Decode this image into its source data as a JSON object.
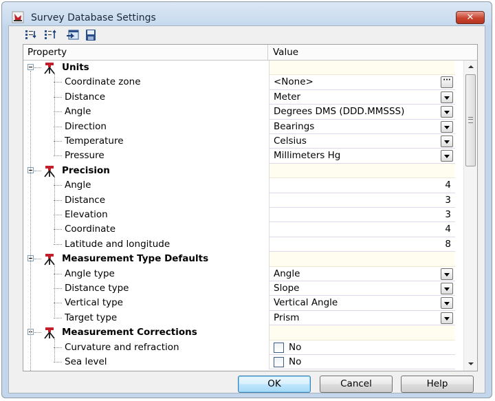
{
  "window": {
    "title": "Survey Database Settings",
    "close_label": "✕"
  },
  "toolbar": {
    "icons": [
      "expand-all-icon",
      "sort-icon",
      "import-icon",
      "save-icon"
    ]
  },
  "grid": {
    "header": {
      "property": "Property",
      "value": "Value"
    },
    "categories": [
      {
        "name": "Units",
        "rows": [
          {
            "label": "Coordinate zone",
            "value": "<None>",
            "control": "ellipsis"
          },
          {
            "label": "Distance",
            "value": "Meter",
            "control": "dropdown"
          },
          {
            "label": "Angle",
            "value": "Degrees DMS (DDD.MMSSS)",
            "control": "dropdown"
          },
          {
            "label": "Direction",
            "value": "Bearings",
            "control": "dropdown"
          },
          {
            "label": "Temperature",
            "value": "Celsius",
            "control": "dropdown"
          },
          {
            "label": "Pressure",
            "value": "Millimeters Hg",
            "control": "dropdown"
          }
        ]
      },
      {
        "name": "Precision",
        "rows": [
          {
            "label": "Angle",
            "value": "4",
            "control": "number"
          },
          {
            "label": "Distance",
            "value": "3",
            "control": "number"
          },
          {
            "label": "Elevation",
            "value": "3",
            "control": "number"
          },
          {
            "label": "Coordinate",
            "value": "4",
            "control": "number"
          },
          {
            "label": "Latitude and longitude",
            "value": "8",
            "control": "number"
          }
        ]
      },
      {
        "name": "Measurement Type Defaults",
        "rows": [
          {
            "label": "Angle type",
            "value": "Angle",
            "control": "dropdown"
          },
          {
            "label": "Distance type",
            "value": "Slope",
            "control": "dropdown"
          },
          {
            "label": "Vertical type",
            "value": "Vertical Angle",
            "control": "dropdown"
          },
          {
            "label": "Target type",
            "value": "Prism",
            "control": "dropdown"
          }
        ]
      },
      {
        "name": "Measurement Corrections",
        "rows": [
          {
            "label": "Curvature and refraction",
            "value": "No",
            "control": "checkbox"
          },
          {
            "label": "Sea level",
            "value": "No",
            "control": "checkbox"
          }
        ]
      }
    ]
  },
  "buttons": {
    "ok": "OK",
    "cancel": "Cancel",
    "help": "Help"
  },
  "colors": {
    "category_value_bg": "#fffdef",
    "default_button": "#bee6fd",
    "close_button": "#c9442f",
    "category_icon": "#c0202a"
  }
}
